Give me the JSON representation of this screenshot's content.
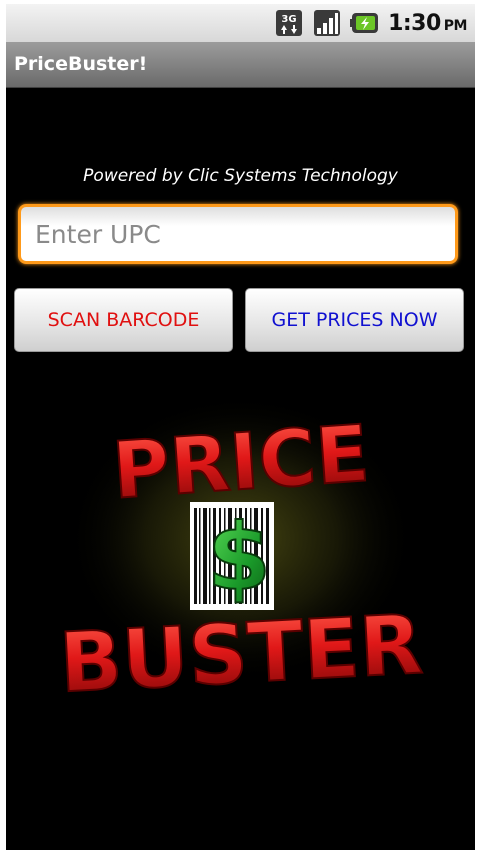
{
  "status_bar": {
    "network": "3G",
    "time": "1:30",
    "ampm": "PM",
    "icons": [
      "network-3g-icon",
      "signal-icon",
      "battery-charging-icon"
    ]
  },
  "app": {
    "title": "PriceBuster!"
  },
  "main": {
    "powered_by": "Powered by Clic Systems Technology",
    "upc_placeholder": "Enter UPC",
    "upc_value": "",
    "scan_button": "SCAN BARCODE",
    "prices_button": "GET PRICES NOW"
  },
  "logo": {
    "word_top": "PRICE",
    "symbol": "$",
    "word_bottom": "BUSTER"
  },
  "colors": {
    "background": "#000000",
    "input_focus": "#ff9a1a",
    "scan_text": "#e01010",
    "prices_text": "#1010d0",
    "logo_red": "#d91818",
    "logo_green": "#1a9a2a"
  }
}
